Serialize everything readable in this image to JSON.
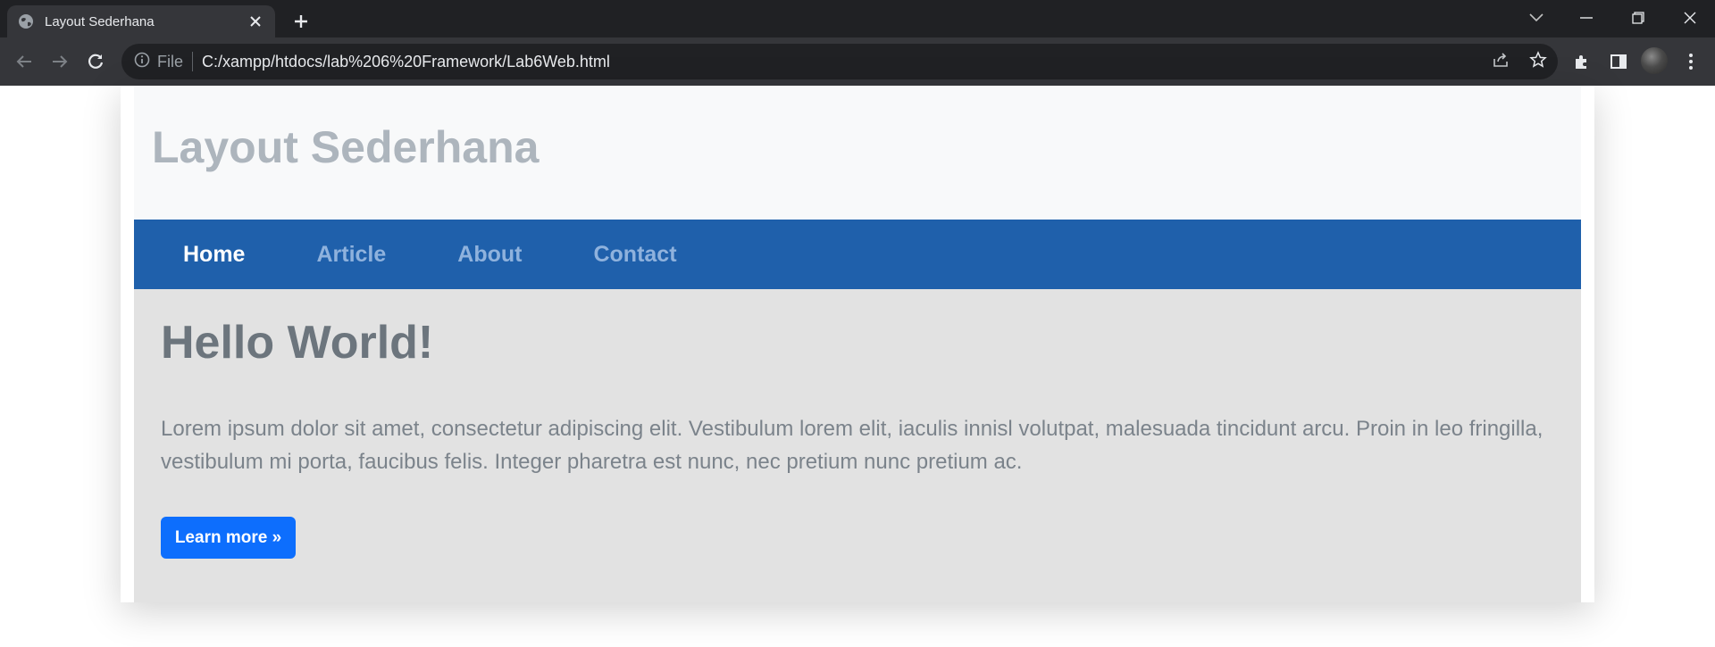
{
  "browser": {
    "tab_title": "Layout Sederhana",
    "site_info_label": "File",
    "url": "C:/xampp/htdocs/lab%206%20Framework/Lab6Web.html",
    "icons": [
      "globe-icon",
      "close-icon",
      "plus-icon",
      "chevron-down-icon",
      "minimize-icon",
      "restore-icon",
      "window-close-icon",
      "back-arrow-icon",
      "forward-arrow-icon",
      "reload-icon",
      "info-icon",
      "share-icon",
      "star-icon",
      "extensions-icon",
      "side-panel-icon",
      "profile-avatar",
      "kebab-menu-icon"
    ]
  },
  "page": {
    "site_title": "Layout Sederhana",
    "nav": [
      {
        "label": "Home",
        "active": true
      },
      {
        "label": "Article",
        "active": false
      },
      {
        "label": "About",
        "active": false
      },
      {
        "label": "Contact",
        "active": false
      }
    ],
    "hero": {
      "heading": "Hello World!",
      "text": "Lorem ipsum dolor sit amet, consectetur adipiscing elit. Vestibulum lorem elit, iaculis innisl volutpat, malesuada tincidunt arcu. Proin in leo fringilla, vestibulum mi porta, faucibus felis. Integer pharetra est nunc, nec pretium nunc pretium ac.",
      "button_label": "Learn more »"
    }
  },
  "colors": {
    "chrome_dark": "#202124",
    "chrome_toolbar": "#35363a",
    "header_bg": "#f8f9fa",
    "title_gray": "#adb5bd",
    "nav_blue": "#1f60ab",
    "nav_link_inactive": "#8fb2dd",
    "jumbotron_bg": "#e2e2e2",
    "heading_gray": "#6c757d",
    "button_blue": "#0d6efd"
  }
}
